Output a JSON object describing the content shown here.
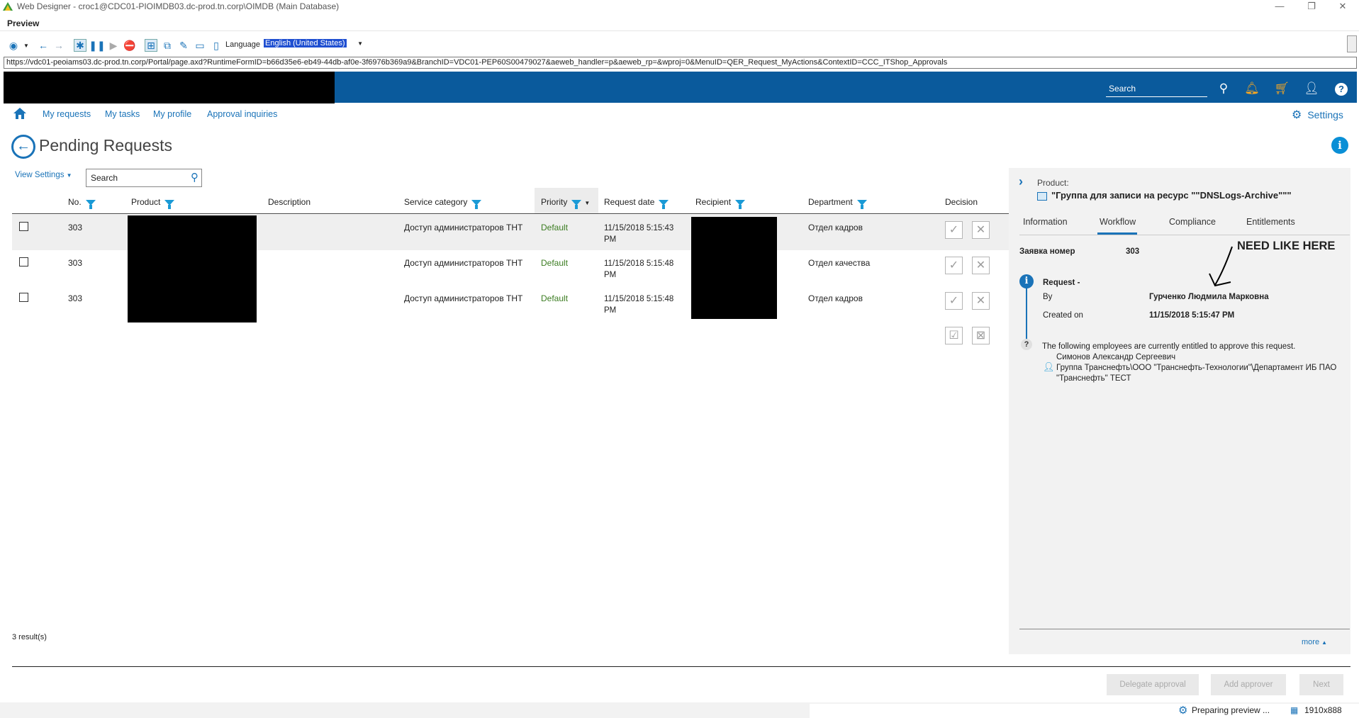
{
  "window": {
    "title": "Web Designer - croc1@CDC01-PIOIMDB03.dc-prod.tn.corp\\OIMDB (Main Database)",
    "menu_label": "Preview"
  },
  "toolbar": {
    "language_label": "Language",
    "language_value": "English (United States)"
  },
  "url": "https://vdc01-peoiams03.dc-prod.tn.corp/Portal/page.axd?RuntimeFormID=b66d35e6-eb49-44db-af0e-3f6976b369a9&BranchID=VDC01-PEP60S00479027&aeweb_handler=p&aeweb_rp=&wproj=0&MenuID=QER_Request_MyActions&ContextID=CCC_ITShop_Approvals",
  "header": {
    "search_placeholder": "Search"
  },
  "nav": {
    "links": [
      "My requests",
      "My tasks",
      "My profile",
      "Approval inquiries"
    ],
    "settings_label": "Settings"
  },
  "page": {
    "title": "Pending Requests",
    "view_settings_label": "View Settings",
    "search_placeholder": "Search",
    "results_text": "3 result(s)"
  },
  "grid": {
    "columns": [
      "No.",
      "Product",
      "Description",
      "Service category",
      "Priority",
      "Request date",
      "Recipient",
      "Department",
      "Decision"
    ],
    "rows": [
      {
        "no": "303",
        "service_category": "Доступ администраторов ТНТ",
        "priority": "Default",
        "date": "11/15/2018 5:15:43 PM",
        "department": "Отдел кадров"
      },
      {
        "no": "303",
        "service_category": "Доступ администраторов ТНТ",
        "priority": "Default",
        "date": "11/15/2018 5:15:48 PM",
        "department": "Отдел качества"
      },
      {
        "no": "303",
        "service_category": "Доступ администраторов ТНТ",
        "priority": "Default",
        "date": "11/15/2018 5:15:48 PM",
        "department": "Отдел кадров"
      }
    ]
  },
  "detail": {
    "product_label": "Product:",
    "product_name": "\"Группа для записи на ресурс \"\"DNSLogs-Archive\"\"\"",
    "tabs": [
      "Information",
      "Workflow",
      "Compliance",
      "Entitlements"
    ],
    "request_number_label": "Заявка номер",
    "request_number_value": "303",
    "workflow": {
      "title": "Request -",
      "by_label": "By",
      "by_value": "Гурченко Людмила Марковна",
      "created_label": "Created on",
      "created_value": "11/15/2018 5:15:47 PM"
    },
    "approvers_text": "The following employees are currently entitled to approve this request.",
    "approver_name": "Симонов Александр Сергеевич",
    "approver_group_line1": "Группа Транснефть\\ООО \"Транснефть-Технологии\"\\Департамент ИБ ПАО",
    "approver_group_line2": "\"Транснефть\" ТЕСТ",
    "annotation": "NEED LIKE HERE",
    "more_label": "more"
  },
  "footer": {
    "delegate_label": "Delegate approval",
    "add_approver_label": "Add approver",
    "next_label": "Next"
  },
  "status": {
    "text": "Preparing preview ...",
    "size": "1910x888"
  },
  "colors": {
    "brand_blue": "#0a5a9c",
    "link_blue": "#1a73b8",
    "priority_green": "#3c7d22"
  }
}
